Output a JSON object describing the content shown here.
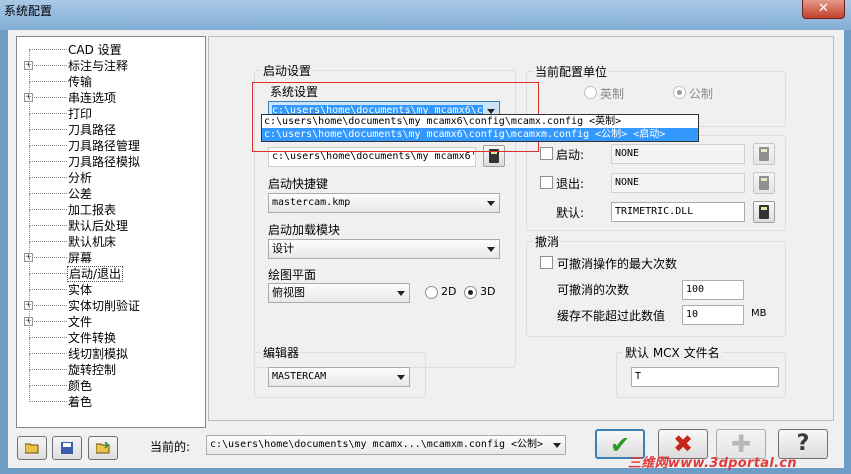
{
  "window": {
    "title": "系统配置",
    "close_glyph": "✕"
  },
  "tree": {
    "items": [
      {
        "label": "CAD 设置",
        "expandable": false
      },
      {
        "label": "标注与注释",
        "expandable": true
      },
      {
        "label": "传输",
        "expandable": false
      },
      {
        "label": "串连选项",
        "expandable": true
      },
      {
        "label": "打印",
        "expandable": false
      },
      {
        "label": "刀具路径",
        "expandable": false
      },
      {
        "label": "刀具路径管理",
        "expandable": false
      },
      {
        "label": "刀具路径模拟",
        "expandable": false
      },
      {
        "label": "分析",
        "expandable": false
      },
      {
        "label": "公差",
        "expandable": false
      },
      {
        "label": "加工报表",
        "expandable": false
      },
      {
        "label": "默认后处理",
        "expandable": false
      },
      {
        "label": "默认机床",
        "expandable": false
      },
      {
        "label": "屏幕",
        "expandable": true
      },
      {
        "label": "启动/退出",
        "expandable": false,
        "selected": true
      },
      {
        "label": "实体",
        "expandable": false
      },
      {
        "label": "实体切削验证",
        "expandable": true
      },
      {
        "label": "文件",
        "expandable": true
      },
      {
        "label": "文件转换",
        "expandable": false
      },
      {
        "label": "线切割模拟",
        "expandable": false
      },
      {
        "label": "旋转控制",
        "expandable": false
      },
      {
        "label": "颜色",
        "expandable": false
      },
      {
        "label": "着色",
        "expandable": false
      }
    ]
  },
  "startup": {
    "group_title": "启动设置",
    "system_config_label": "系统设置",
    "system_config_value": "c:\\users\\home\\documents\\my mcamx6\\c",
    "dropdown_options": [
      "c:\\users\\home\\documents\\my mcamx6\\config\\mcamx.config <英制>",
      "c:\\users\\home\\documents\\my mcamx6\\config\\mcamxm.config <公制> <启动>"
    ],
    "hidden_path_value": "c:\\users\\home\\documents\\my mcamx6'",
    "hotkey_label": "启动快捷键",
    "hotkey_value": "mastercam.kmp",
    "addin_label": "启动加载模块",
    "addin_value": "设计",
    "plane_label": "绘图平面",
    "plane_value": "俯视图",
    "radio_2d": "2D",
    "radio_3d": "3D"
  },
  "units": {
    "group_title": "当前配置单位",
    "imperial": "英制",
    "metric": "公制",
    "startup_label": "启动:",
    "startup_value": "NONE",
    "exit_label": "退出:",
    "exit_value": "NONE",
    "default_label": "默认:",
    "default_value": "TRIMETRIC.DLL"
  },
  "undo": {
    "group_title": "撤消",
    "max_undo_label": "可撤消操作的最大次数",
    "undo_count_label": "可撤消的次数",
    "undo_count_value": "100",
    "buffer_label": "缓存不能超过此数值",
    "buffer_value": "10",
    "buffer_unit": "MB"
  },
  "editor": {
    "group_title": "编辑器",
    "value": "MASTERCAM"
  },
  "mcx": {
    "group_title": "默认 MCX 文件名",
    "value": "T"
  },
  "bottom": {
    "current_label": "当前的:",
    "current_value": "c:\\users\\home\\documents\\my mcamx...\\mcamxm.config <公制>",
    "ok_glyph": "✔",
    "cancel_glyph": "✖",
    "add_glyph": "✚",
    "help_glyph": "?",
    "watermark": "三维网www.3dportal.cn"
  },
  "colors": {
    "ok": "#2f9a21",
    "cancel": "#c7261c",
    "selection": "#3399ff",
    "highlight_frame": "#d9302a"
  }
}
